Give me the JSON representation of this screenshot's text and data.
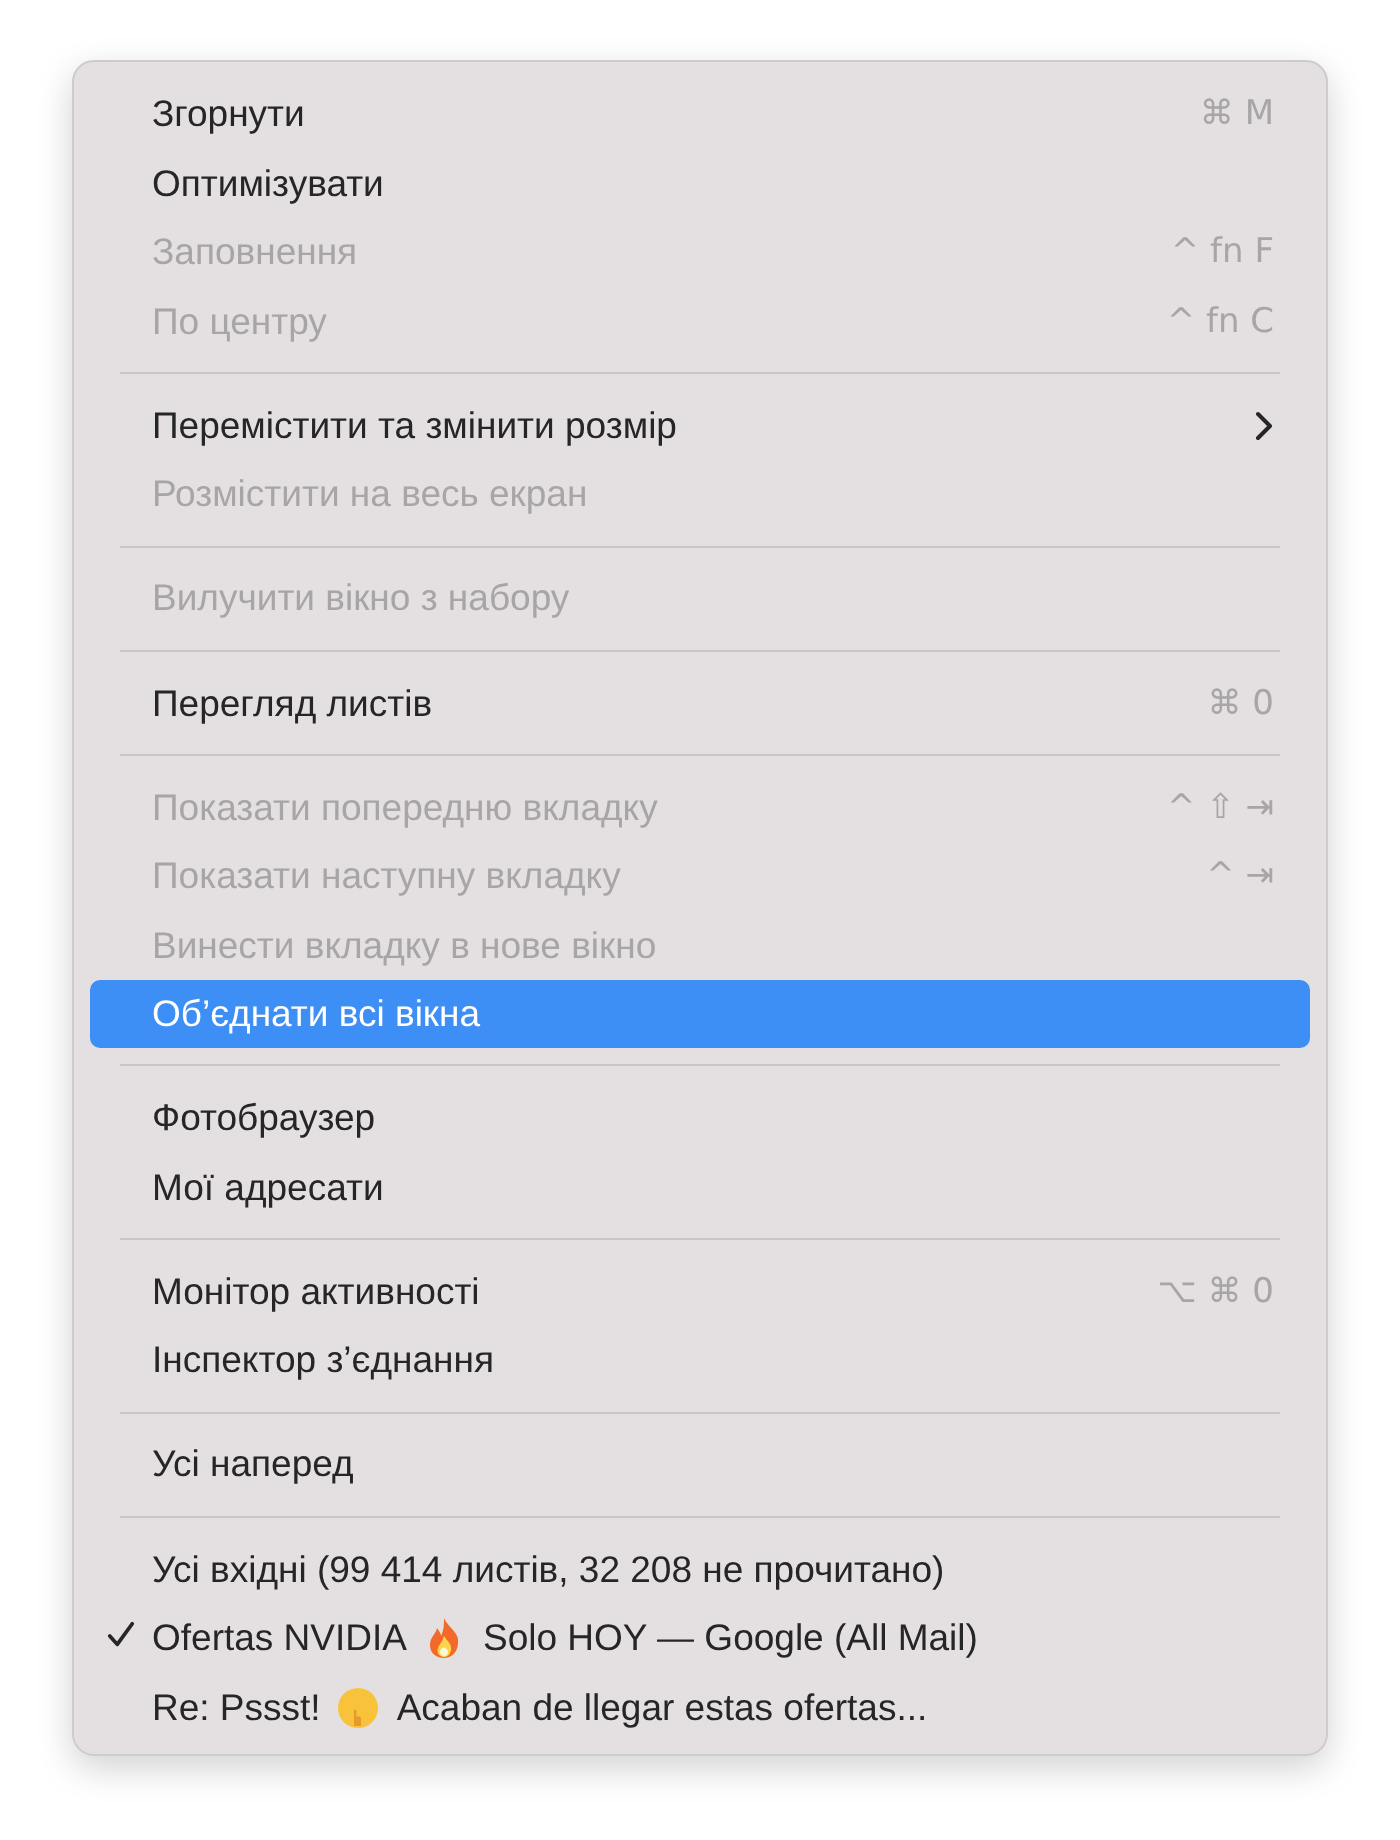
{
  "menu": {
    "sections": [
      {
        "items": [
          {
            "label": "Згорнути",
            "shortcut": "⌘ M",
            "disabled": false,
            "selected": false
          },
          {
            "label": "Оптимізувати",
            "disabled": false,
            "selected": false
          },
          {
            "label": "Заповнення",
            "shortcut": "^ fn F",
            "disabled": true,
            "selected": false
          },
          {
            "label": "По центру",
            "shortcut": "^ fn C",
            "disabled": true,
            "selected": false
          }
        ]
      },
      {
        "items": [
          {
            "label": "Перемістити та змінити розмір",
            "submenu": true,
            "disabled": false,
            "selected": false
          },
          {
            "label": "Розмістити на весь екран",
            "disabled": true,
            "selected": false
          }
        ]
      },
      {
        "items": [
          {
            "label": "Вилучити вікно з набору",
            "disabled": true,
            "selected": false
          }
        ]
      },
      {
        "items": [
          {
            "label": "Перегляд листів",
            "shortcut": "⌘ 0",
            "disabled": false,
            "selected": false
          }
        ]
      },
      {
        "items": [
          {
            "label": "Показати попередню вкладку",
            "shortcut": "^ ⇧ ⇥",
            "disabled": true,
            "selected": false
          },
          {
            "label": "Показати наступну вкладку",
            "shortcut": "^ ⇥",
            "disabled": true,
            "selected": false
          },
          {
            "label": "Винести вкладку в нове вікно",
            "disabled": true,
            "selected": false
          },
          {
            "label": "Об’єднати всі вікна",
            "disabled": false,
            "selected": true
          }
        ]
      },
      {
        "items": [
          {
            "label": "Фотобраузер",
            "disabled": false,
            "selected": false
          },
          {
            "label": "Мої адресати",
            "disabled": false,
            "selected": false
          }
        ]
      },
      {
        "items": [
          {
            "label": "Монітор активності",
            "shortcut": "⌥ ⌘ 0",
            "disabled": false,
            "selected": false
          },
          {
            "label": "Інспектор з’єднання",
            "disabled": false,
            "selected": false
          }
        ]
      },
      {
        "items": [
          {
            "label": "Усі наперед",
            "disabled": false,
            "selected": false
          }
        ]
      },
      {
        "items": [
          {
            "label": "Усі вхідні (99 414 листів, 32 208 не прочитано)",
            "disabled": false,
            "selected": false,
            "checked": false
          },
          {
            "parts": [
              {
                "kind": "text",
                "text": "Ofertas NVIDIA"
              },
              {
                "kind": "flame"
              },
              {
                "kind": "text",
                "text": "Solo HOY — Google (All Mail)"
              }
            ],
            "disabled": false,
            "selected": false,
            "checked": true
          },
          {
            "parts": [
              {
                "kind": "text",
                "text": "Re: Pssst!"
              },
              {
                "kind": "smiley"
              },
              {
                "kind": "text",
                "text": "Acaban de llegar estas ofertas..."
              }
            ],
            "disabled": false,
            "selected": false,
            "checked": false
          }
        ]
      }
    ]
  }
}
